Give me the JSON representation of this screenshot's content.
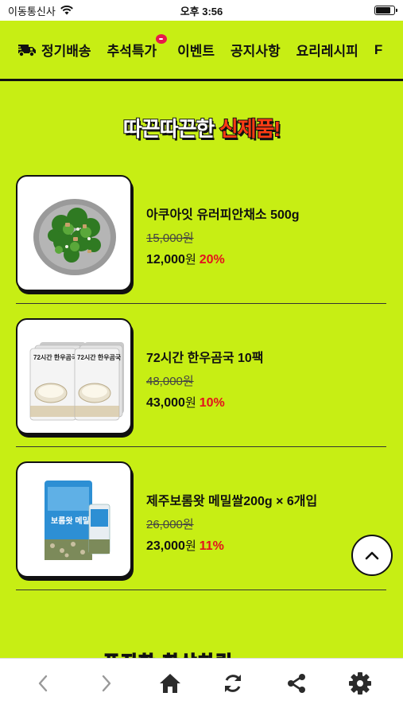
{
  "status": {
    "carrier": "이동통신사",
    "time": "오후 3:56",
    "battery_level": 0.9
  },
  "nav": {
    "items": [
      {
        "label": "정기배송",
        "icon": "truck-icon"
      },
      {
        "label": "추석특가",
        "badge": true
      },
      {
        "label": "이벤트"
      },
      {
        "label": "공지사항"
      },
      {
        "label": "요리레시피"
      },
      {
        "label": "F"
      }
    ]
  },
  "section": {
    "title_plain": "따끈따끈한",
    "title_highlight": "신제품!"
  },
  "products": [
    {
      "name": "아쿠아잇 유러피안채소 500g",
      "original_price": "15,000원",
      "price": "12,000",
      "currency": "원",
      "discount": "20%",
      "image": "salad-bowl"
    },
    {
      "name": "72시간 한우곰국 10팩",
      "original_price": "48,000원",
      "price": "43,000",
      "currency": "원",
      "discount": "10%",
      "image": "beef-soup-pouches",
      "pack_text": "72시간 한우곰국"
    },
    {
      "name": "제주보롬왓 메밀쌀200g × 6개입",
      "original_price": "26,000원",
      "price": "23,000",
      "currency": "원",
      "discount": "11%",
      "image": "buckwheat-rice-pack",
      "pack_text": "보롬왓 메밀쌀"
    }
  ],
  "next_section_peek": "푸짐한 한상차림",
  "bottom_bar": {
    "icons": [
      "back-arrow-icon",
      "forward-arrow-icon",
      "home-icon",
      "refresh-icon",
      "share-icon",
      "settings-gear-icon"
    ]
  }
}
